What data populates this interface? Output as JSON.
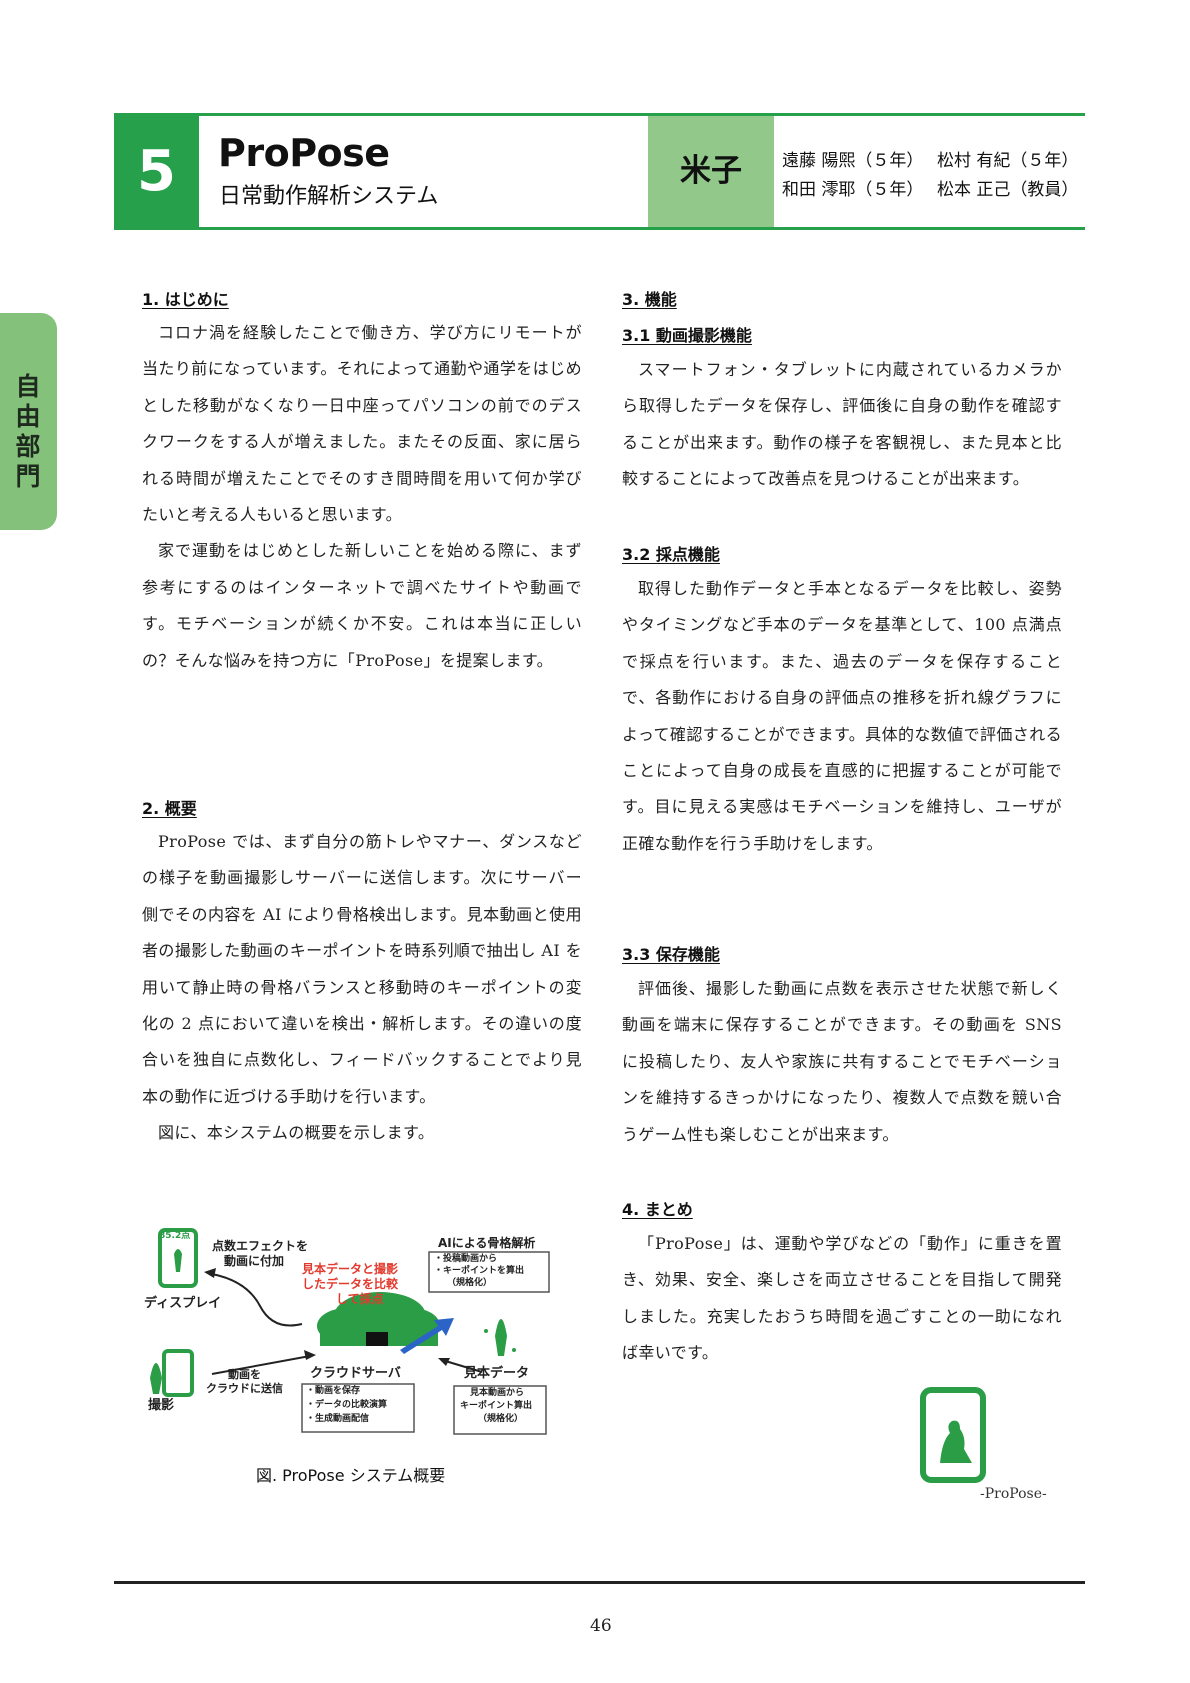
{
  "side_tab": {
    "label": "自由部門"
  },
  "header": {
    "number": "5",
    "title": "ProPose",
    "subtitle": "日常動作解析システム",
    "school": "米子",
    "members": [
      "遠藤 陽煕（５年）",
      "松村 有紀（５年）",
      "和田 澪耶（５年）",
      "松本 正己（教員）"
    ]
  },
  "left_column": {
    "section1": {
      "heading": "1. はじめに",
      "paragraphs": [
        "コロナ渦を経験したことで働き方、学び方にリモートが当たり前になっています。それによって通勤や通学をはじめとした移動がなくなり一日中座ってパソコンの前でのデスクワークをする人が増えました。またその反面、家に居られる時間が増えたことでそのすき間時間を用いて何か学びたいと考える人もいると思います。",
        "家で運動をはじめとした新しいことを始める際に、まず参考にするのはインターネットで調べたサイトや動画です。モチベーションが続くか不安。これは本当に正しいの？そんな悩みを持つ方に「ProPose」を提案します。"
      ]
    },
    "section2": {
      "heading": "2. 概要",
      "paragraphs": [
        "ProPose では、まず自分の筋トレやマナー、ダンスなどの様子を動画撮影しサーバーに送信します。次にサーバー側でその内容を AI により骨格検出します。見本動画と使用者の撮影した動画のキーポイントを時系列順で抽出し AI を用いて静止時の骨格バランスと移動時のキーポイントの変化の 2 点において違いを検出・解析します。その違いの度合いを独自に点数化し、フィードバックすることでより見本の動作に近づける手助けを行います。",
        "図に、本システムの概要を示します。"
      ]
    }
  },
  "figure": {
    "score": "85.2点",
    "label_effect": [
      "点数エフェクトを",
      "動画に付加"
    ],
    "label_display": "ディスプレイ",
    "label_compare": [
      "見本データと撮影",
      "したデータを比較",
      "して採点"
    ],
    "label_ai_title": "AIによる骨格解析",
    "label_ai_items": [
      "・投稿動画から",
      "・キーポイントを算出",
      "（規格化）"
    ],
    "label_send": [
      "動画を",
      "クラウドに送信"
    ],
    "label_shoot": "撮影",
    "label_cloud": "クラウドサーバ",
    "label_cloud_items": [
      "・動画を保存",
      "・データの比較演算",
      "・生成動画配信"
    ],
    "label_sample_title": "見本データ",
    "label_sample_items": [
      "見本動画から",
      "キーポイント算出",
      "（規格化）"
    ],
    "caption": "図. ProPose システム概要"
  },
  "right_column": {
    "section3": {
      "heading": "3. 機能",
      "sub1": {
        "heading": "3.1 動画撮影機能",
        "paragraphs": [
          "スマートフォン・タブレットに内蔵されているカメラから取得したデータを保存し、評価後に自身の動作を確認することが出来ます。動作の様子を客観視し、また見本と比較することによって改善点を見つけることが出来ます。"
        ]
      },
      "sub2": {
        "heading": "3.2 採点機能",
        "paragraphs": [
          "取得した動作データと手本となるデータを比較し、姿勢やタイミングなど手本のデータを基準として、100 点満点で採点を行います。また、過去のデータを保存することで、各動作における自身の評価点の推移を折れ線グラフによって確認することができます。具体的な数値で評価されることによって自身の成長を直感的に把握することが可能です。目に見える実感はモチベーションを維持し、ユーザが正確な動作を行う手助けをします。"
        ]
      },
      "sub3": {
        "heading": "3.3 保存機能",
        "paragraphs": [
          "評価後、撮影した動画に点数を表示させた状態で新しく動画を端末に保存することができます。その動画を SNS に投稿したり、友人や家族に共有することでモチベーションを維持するきっかけになったり、複数人で点数を競い合うゲーム性も楽しむことが出来ます。"
        ]
      }
    },
    "section4": {
      "heading": "4. まとめ",
      "paragraphs": [
        "「ProPose」は、運動や学びなどの「動作」に重きを置き、効果、安全、楽しさを両立させることを目指して開発しました。充実したおうち時間を過ごすことの一助になれば幸いです。"
      ]
    },
    "logo_caption": "-ProPose-"
  },
  "footer": {
    "page_number": "46"
  },
  "colors": {
    "brand_green": "#26a04a",
    "school_green": "#92c98b",
    "tab_green": "#84c27b"
  }
}
